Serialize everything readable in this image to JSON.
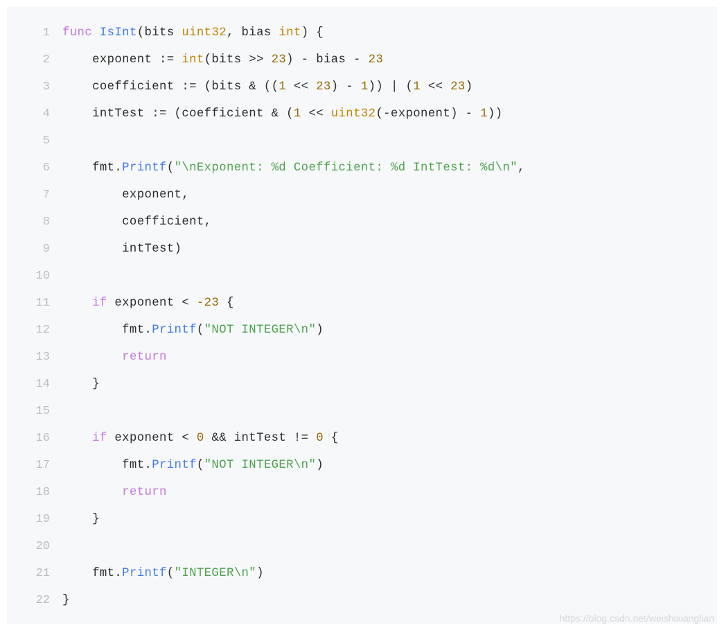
{
  "watermark": "https://blog.csdn.net/weishixianglian",
  "code": {
    "lines": [
      {
        "n": "1",
        "tokens": [
          [
            "kw",
            "func"
          ],
          [
            "",
            " "
          ],
          [
            "fn",
            "IsInt"
          ],
          [
            "",
            "(bits "
          ],
          [
            "typ",
            "uint32"
          ],
          [
            "",
            ", bias "
          ],
          [
            "typ",
            "int"
          ],
          [
            "",
            ") {"
          ]
        ]
      },
      {
        "n": "2",
        "tokens": [
          [
            "",
            "    exponent := "
          ],
          [
            "typ",
            "int"
          ],
          [
            "",
            "(bits >> "
          ],
          [
            "num",
            "23"
          ],
          [
            "",
            ") - bias - "
          ],
          [
            "num",
            "23"
          ]
        ]
      },
      {
        "n": "3",
        "tokens": [
          [
            "",
            "    coefficient := (bits & (("
          ],
          [
            "num",
            "1"
          ],
          [
            "",
            " << "
          ],
          [
            "num",
            "23"
          ],
          [
            "",
            ") - "
          ],
          [
            "num",
            "1"
          ],
          [
            "",
            ")) | ("
          ],
          [
            "num",
            "1"
          ],
          [
            "",
            " << "
          ],
          [
            "num",
            "23"
          ],
          [
            "",
            ")"
          ]
        ]
      },
      {
        "n": "4",
        "tokens": [
          [
            "",
            "    intTest := (coefficient & ("
          ],
          [
            "num",
            "1"
          ],
          [
            "",
            " << "
          ],
          [
            "typ",
            "uint32"
          ],
          [
            "",
            "(-exponent) - "
          ],
          [
            "num",
            "1"
          ],
          [
            "",
            "))"
          ]
        ]
      },
      {
        "n": "5",
        "tokens": [
          [
            "",
            " "
          ]
        ]
      },
      {
        "n": "6",
        "tokens": [
          [
            "",
            "    fmt."
          ],
          [
            "fn",
            "Printf"
          ],
          [
            "",
            "("
          ],
          [
            "str",
            "\"\\nExponent: %d Coefficient: %d IntTest: %d\\n\""
          ],
          [
            "",
            ","
          ]
        ]
      },
      {
        "n": "7",
        "tokens": [
          [
            "",
            "        exponent,"
          ]
        ]
      },
      {
        "n": "8",
        "tokens": [
          [
            "",
            "        coefficient,"
          ]
        ]
      },
      {
        "n": "9",
        "tokens": [
          [
            "",
            "        intTest)"
          ]
        ]
      },
      {
        "n": "10",
        "tokens": [
          [
            "",
            " "
          ]
        ]
      },
      {
        "n": "11",
        "tokens": [
          [
            "",
            "    "
          ],
          [
            "kw",
            "if"
          ],
          [
            "",
            " exponent < "
          ],
          [
            "num",
            "-23"
          ],
          [
            "",
            " {"
          ]
        ]
      },
      {
        "n": "12",
        "tokens": [
          [
            "",
            "        fmt."
          ],
          [
            "fn",
            "Printf"
          ],
          [
            "",
            "("
          ],
          [
            "str",
            "\"NOT INTEGER\\n\""
          ],
          [
            "",
            ")"
          ]
        ]
      },
      {
        "n": "13",
        "tokens": [
          [
            "",
            "        "
          ],
          [
            "kw",
            "return"
          ]
        ]
      },
      {
        "n": "14",
        "tokens": [
          [
            "",
            "    }"
          ]
        ]
      },
      {
        "n": "15",
        "tokens": [
          [
            "",
            " "
          ]
        ]
      },
      {
        "n": "16",
        "tokens": [
          [
            "",
            "    "
          ],
          [
            "kw",
            "if"
          ],
          [
            "",
            " exponent < "
          ],
          [
            "num",
            "0"
          ],
          [
            "",
            " && intTest != "
          ],
          [
            "num",
            "0"
          ],
          [
            "",
            " {"
          ]
        ]
      },
      {
        "n": "17",
        "tokens": [
          [
            "",
            "        fmt."
          ],
          [
            "fn",
            "Printf"
          ],
          [
            "",
            "("
          ],
          [
            "str",
            "\"NOT INTEGER\\n\""
          ],
          [
            "",
            ")"
          ]
        ]
      },
      {
        "n": "18",
        "tokens": [
          [
            "",
            "        "
          ],
          [
            "kw",
            "return"
          ]
        ]
      },
      {
        "n": "19",
        "tokens": [
          [
            "",
            "    }"
          ]
        ]
      },
      {
        "n": "20",
        "tokens": [
          [
            "",
            " "
          ]
        ]
      },
      {
        "n": "21",
        "tokens": [
          [
            "",
            "    fmt."
          ],
          [
            "fn",
            "Printf"
          ],
          [
            "",
            "("
          ],
          [
            "str",
            "\"INTEGER\\n\""
          ],
          [
            "",
            ")"
          ]
        ]
      },
      {
        "n": "22",
        "tokens": [
          [
            "",
            "}"
          ]
        ]
      }
    ]
  }
}
